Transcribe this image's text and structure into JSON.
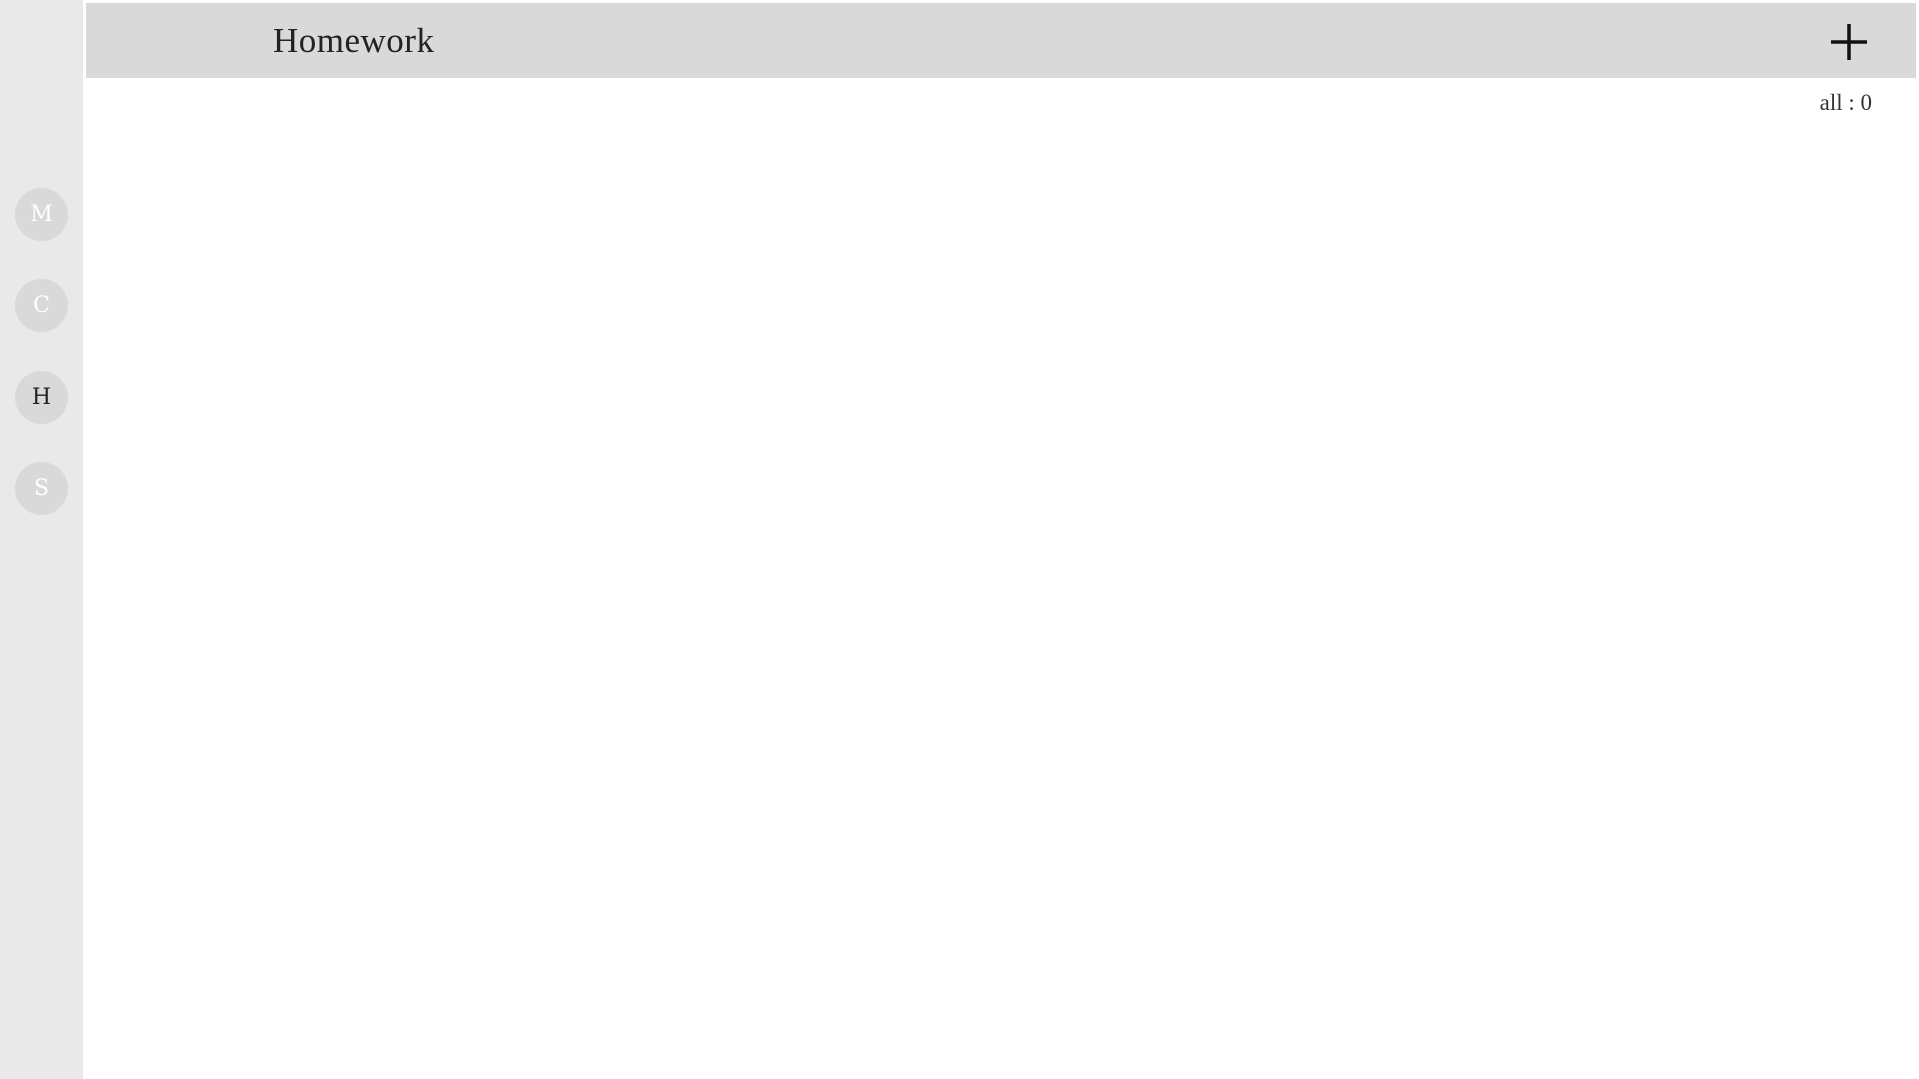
{
  "header": {
    "title": "Homework",
    "add_icon": "plus-icon"
  },
  "sidebar": {
    "items": [
      {
        "label": "M",
        "active": false
      },
      {
        "label": "C",
        "active": false
      },
      {
        "label": "H",
        "active": true
      },
      {
        "label": "S",
        "active": false
      }
    ]
  },
  "summary": {
    "count_text": "all : 0"
  },
  "colors": {
    "sidebar_bg": "#e9e9e9",
    "header_bg": "#d9d9d9",
    "nav_circle": "#d9d9d9",
    "nav_text_inactive": "#ffffff",
    "nav_text_active": "#222222"
  }
}
